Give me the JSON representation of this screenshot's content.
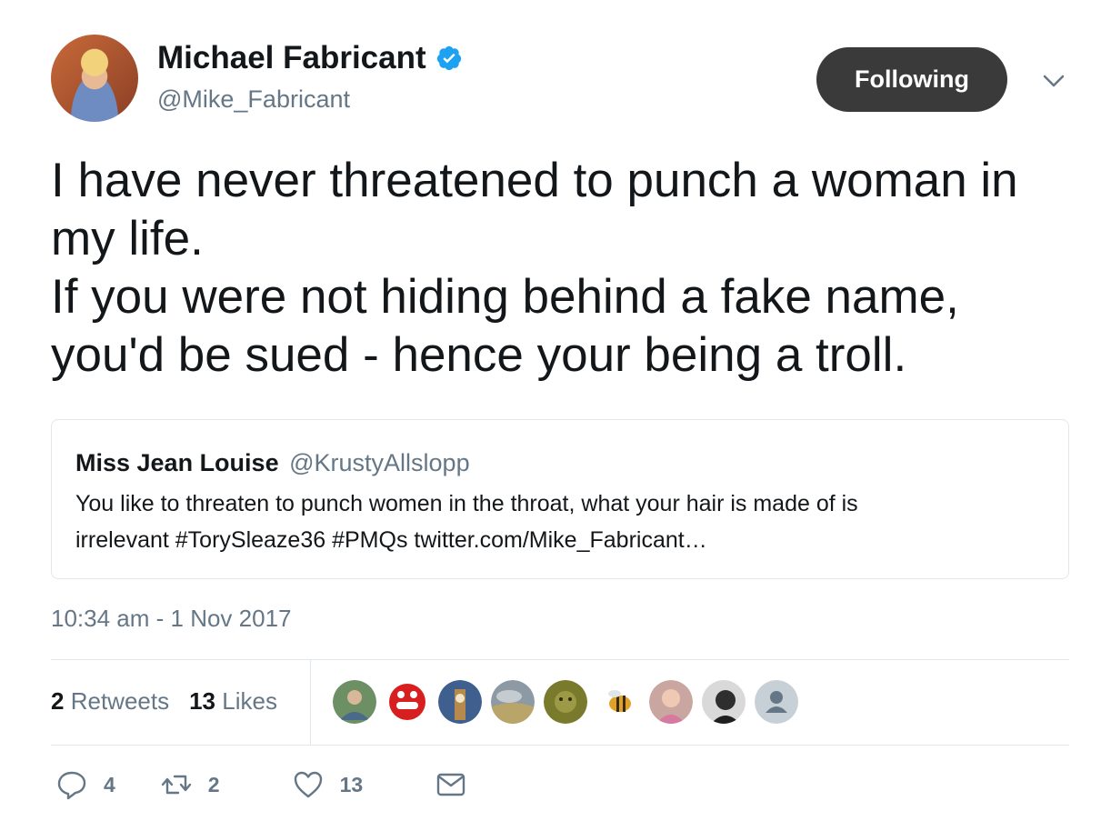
{
  "author": {
    "display_name": "Michael Fabricant",
    "handle": "@Mike_Fabricant",
    "verified": true
  },
  "follow_button_label": "Following",
  "tweet_lines": [
    "I have never threatened to punch a woman in",
    "my life.",
    "If you were not hiding behind a fake name,",
    "you'd be sued - hence your being a troll."
  ],
  "quoted_tweet": {
    "name": "Miss Jean Louise",
    "handle": "@KrustyAllslopp",
    "text_lines": [
      "You like to threaten to punch women in the throat, what your hair is made of is",
      "irrelevant #TorySleaze36 #PMQs twitter.com/Mike_Fabricant…"
    ]
  },
  "timestamp": "10:34 am - 1 Nov 2017",
  "stats": {
    "retweets_count": "2",
    "retweets_label": "Retweets",
    "likes_count": "13",
    "likes_label": "Likes"
  },
  "liker_avatars": [
    {
      "icon": "user-avatar-green",
      "color": "#6d8f64"
    },
    {
      "icon": "user-avatar-red",
      "color": "#d81f1f"
    },
    {
      "icon": "user-avatar-bigben",
      "color": "#3f5f8f"
    },
    {
      "icon": "user-avatar-sky",
      "color": "#8d9aa3"
    },
    {
      "icon": "user-avatar-greenman",
      "color": "#7a7a2c"
    },
    {
      "icon": "user-avatar-bee",
      "color": "#e0a12a"
    },
    {
      "icon": "user-avatar-woman",
      "color": "#c9a6a0"
    },
    {
      "icon": "user-avatar-bw",
      "color": "#2e2e2e"
    },
    {
      "icon": "default-avatar",
      "color": "#c7d0d6"
    }
  ],
  "actions": {
    "reply_count": "4",
    "retweet_count": "2",
    "like_count": "13"
  },
  "colors": {
    "text": "#14171a",
    "secondary": "#657786",
    "verified_blue": "#1da1f2",
    "button_bg": "#3a3a3a",
    "border": "#e1e8ed"
  }
}
